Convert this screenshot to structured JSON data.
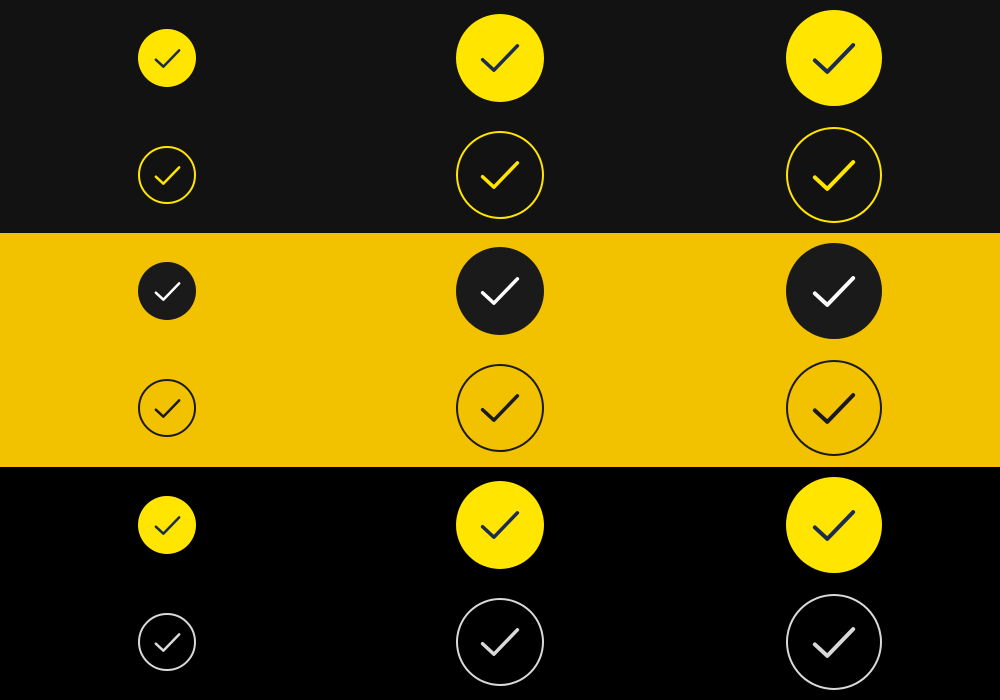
{
  "colors": {
    "dark_band": "#121212",
    "yellow_band": "#F2C100",
    "black_band": "#000000",
    "bright_yellow": "#FFE500",
    "navy": "#1B2C4F",
    "charcoal": "#1A1A1A",
    "white": "#FFFFFF",
    "light_gray": "#D9D9D9"
  },
  "bands": [
    {
      "name": "dark-band",
      "color": "#121212",
      "rows": [
        {
          "variant": "filled",
          "fill": "#FFE500",
          "stroke": "none",
          "check": "#1B2C4F",
          "icon": "check-circle-filled-icon"
        },
        {
          "variant": "outline",
          "fill": "none",
          "stroke": "#FFE500",
          "check": "#FFE500",
          "icon": "check-circle-outline-icon"
        }
      ]
    },
    {
      "name": "yellow-band",
      "color": "#F2C100",
      "rows": [
        {
          "variant": "filled",
          "fill": "#1A1A1A",
          "stroke": "none",
          "check": "#FFFFFF",
          "icon": "check-circle-filled-icon"
        },
        {
          "variant": "outline",
          "fill": "none",
          "stroke": "#1A1A1A",
          "check": "#1A1A1A",
          "icon": "check-circle-outline-icon"
        }
      ]
    },
    {
      "name": "black-band",
      "color": "#000000",
      "rows": [
        {
          "variant": "filled",
          "fill": "#FFE500",
          "stroke": "none",
          "check": "#1B2C4F",
          "icon": "check-circle-filled-icon"
        },
        {
          "variant": "outline",
          "fill": "none",
          "stroke": "#D9D9D9",
          "check": "#D9D9D9",
          "icon": "check-circle-outline-icon"
        }
      ]
    }
  ],
  "sizes": [
    "small",
    "medium",
    "large"
  ]
}
